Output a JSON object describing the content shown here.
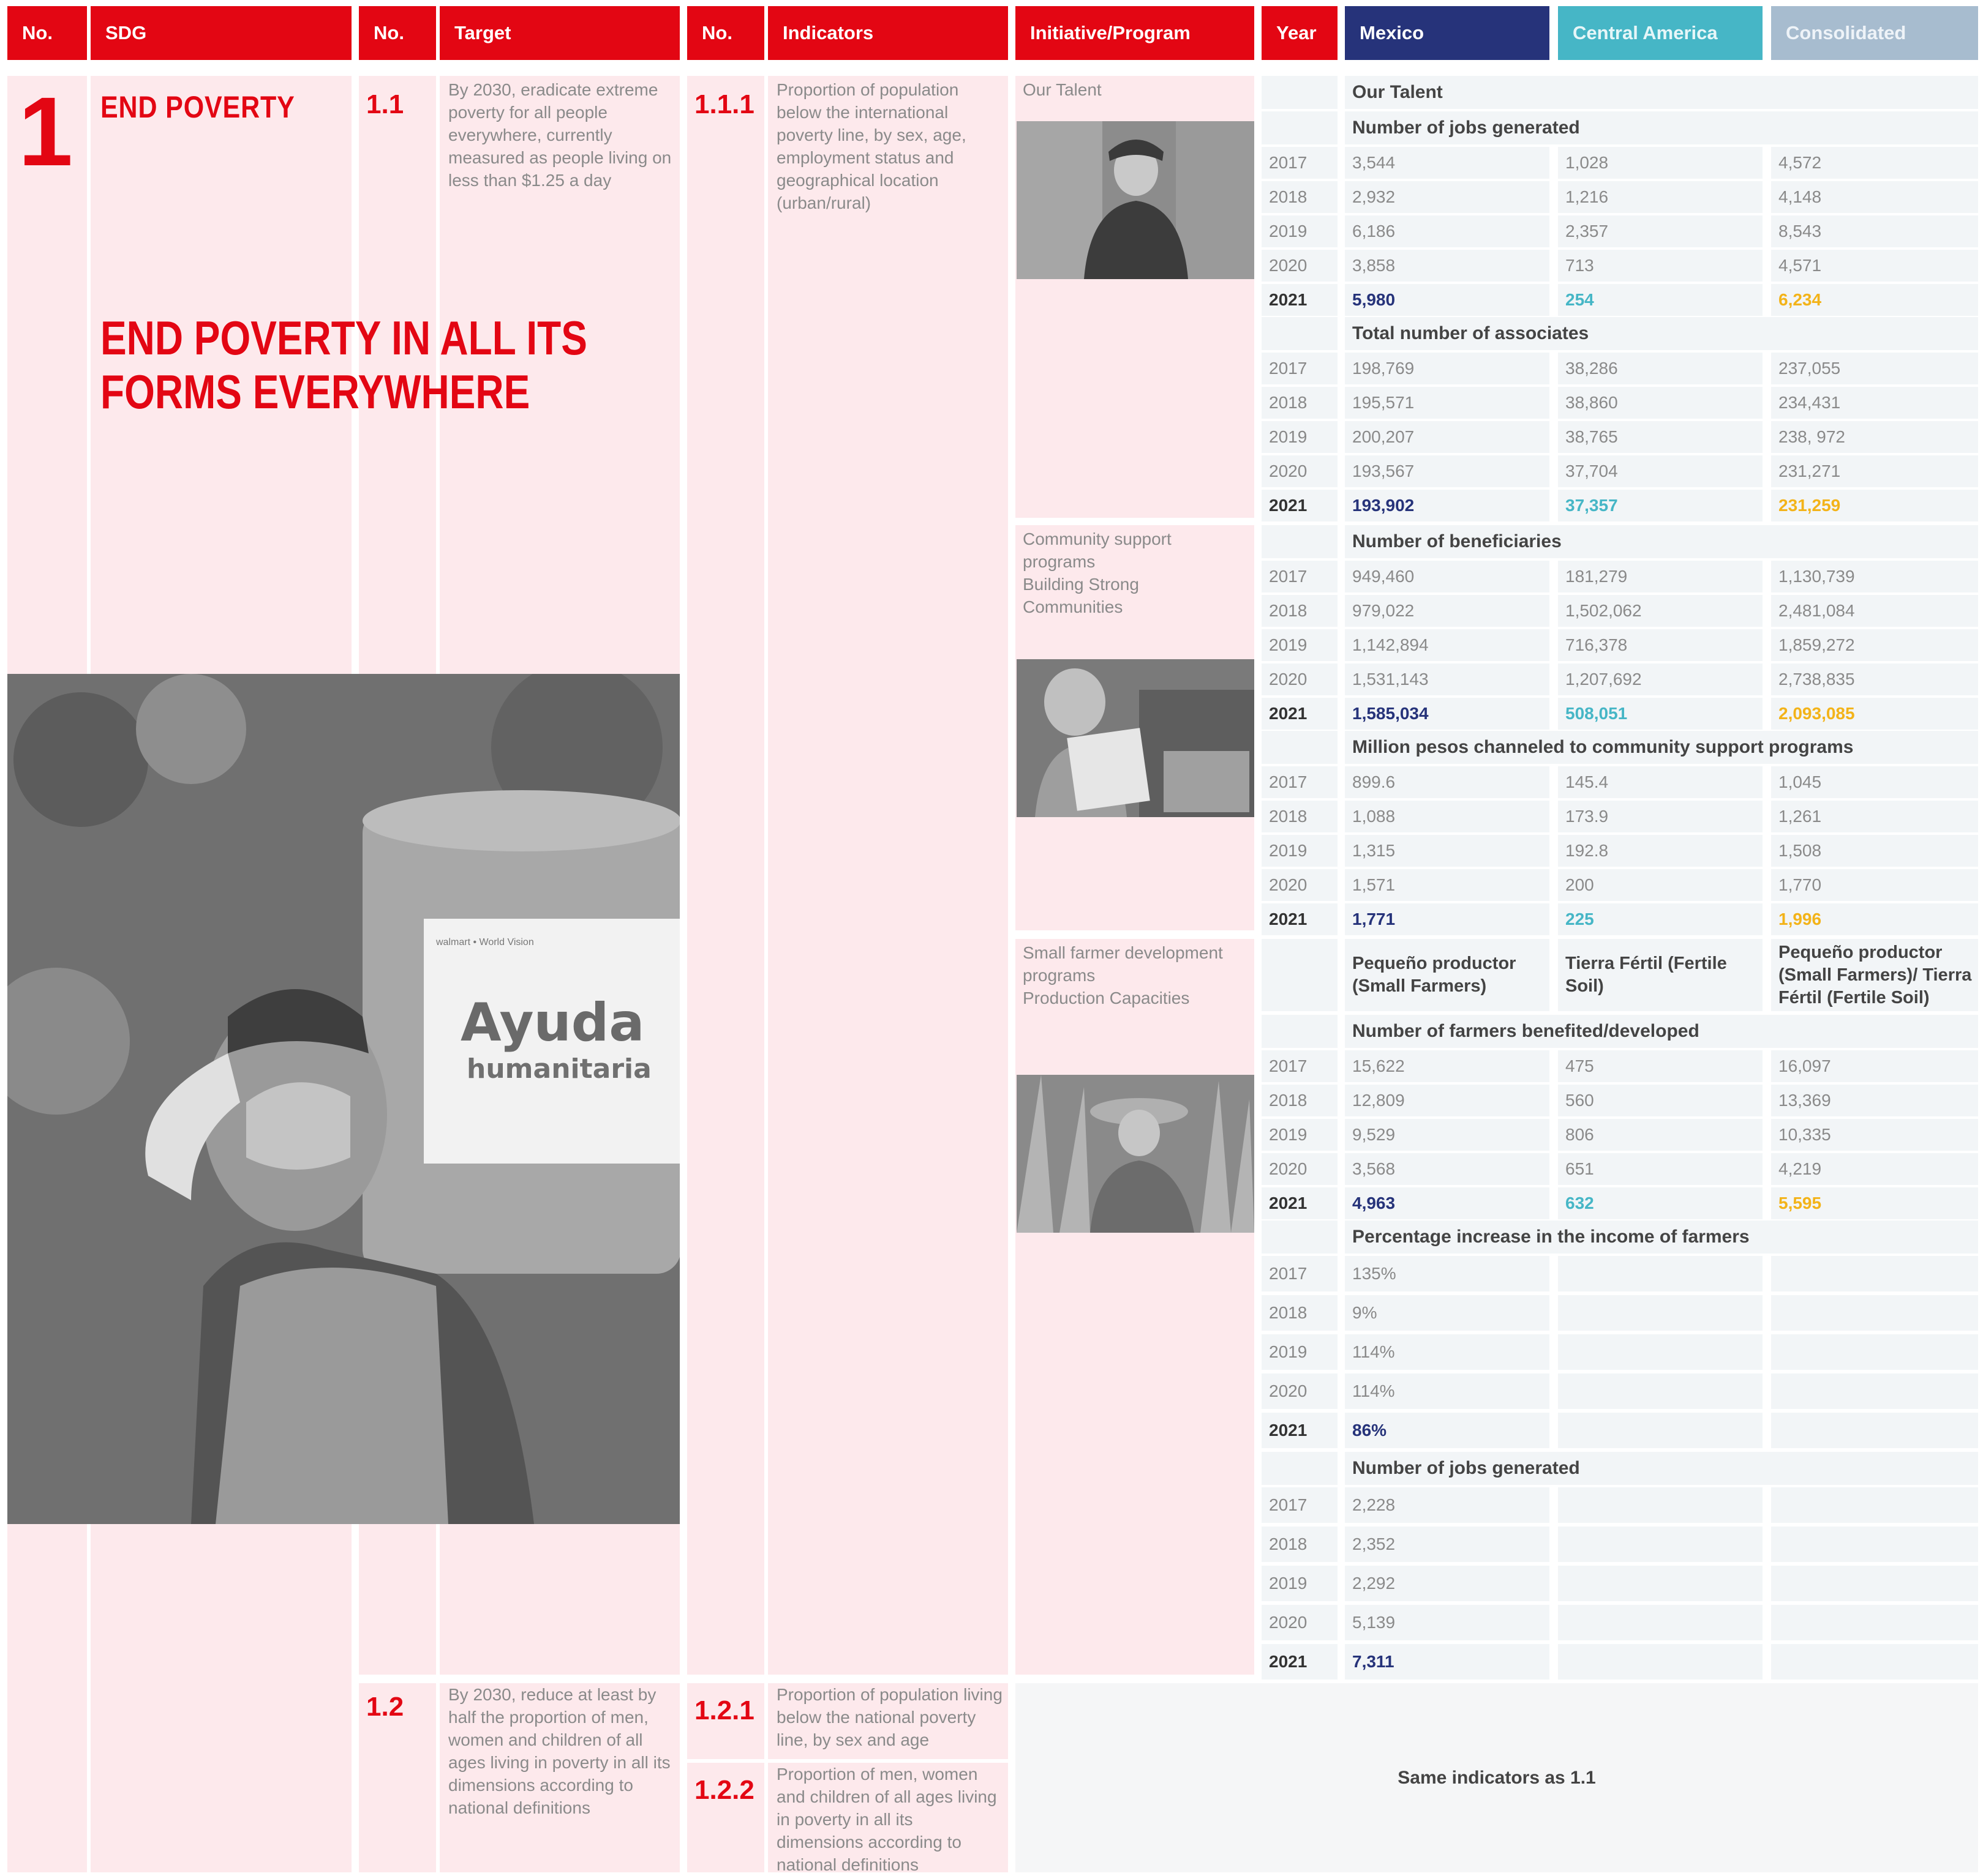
{
  "header": {
    "no1": "No.",
    "sdg": "SDG",
    "no2": "No.",
    "target": "Target",
    "no3": "No.",
    "indicators": "Indicators",
    "initiative": "Initiative/Program",
    "year": "Year",
    "mexico": "Mexico",
    "central_america": "Central America",
    "consolidated": "Consolidated",
    "colors": {
      "red": "#e30613",
      "mexico": "#26337a",
      "central_america": "#46b6c6",
      "consolidated": "#a7bccf"
    }
  },
  "sdg": {
    "number": "1",
    "title": "END POVERTY",
    "subtitle": "END POVERTY IN ALL ITS FORMS EVERYWHERE"
  },
  "targets": [
    {
      "no": "1.1",
      "text": "By 2030, eradicate extreme poverty for  all people everywhere, currently measured as people living on less than $1.25 a day"
    },
    {
      "no": "1.2",
      "text": "By 2030, reduce at least by half the proportion of men, women and children of all ages living in poverty in all its dimensions according to national definitions"
    }
  ],
  "indicators": [
    {
      "no": "1.1.1",
      "text": "Proportion of population below the international poverty line, by sex, age, employment status and geographical location (urban/rural)"
    },
    {
      "no": "1.2.1",
      "text": "Proportion of population living below the national poverty line, by sex and age"
    },
    {
      "no": "1.2.2",
      "text": "Proportion of men, women and children of all ages living in poverty in all its dimensions according to national definitions"
    }
  ],
  "initiatives": {
    "talent": "Our Talent",
    "community": [
      "Community support",
      "programs",
      "Building Strong",
      "Communities"
    ],
    "farmer": [
      "Small farmer development",
      "programs",
      "Production Capacities"
    ]
  },
  "photos": {
    "main_label_1": "Ayuda",
    "main_label_2": "humanitaria",
    "main_logos": "walmart • World Vision"
  },
  "tables": {
    "talent_title": "Our Talent",
    "jobs": {
      "title": "Number of jobs generated",
      "rows": [
        [
          "2017",
          "3,544",
          "1,028",
          "4,572"
        ],
        [
          "2018",
          "2,932",
          "1,216",
          "4,148"
        ],
        [
          "2019",
          "6,186",
          "2,357",
          "8,543"
        ],
        [
          "2020",
          "3,858",
          "713",
          "4,571"
        ],
        [
          "2021",
          "5,980",
          "254",
          "6,234"
        ]
      ]
    },
    "associates": {
      "title": "Total number of associates",
      "rows": [
        [
          "2017",
          "198,769",
          "38,286",
          "237,055"
        ],
        [
          "2018",
          "195,571",
          "38,860",
          "234,431"
        ],
        [
          "2019",
          "200,207",
          "38,765",
          "238, 972"
        ],
        [
          "2020",
          "193,567",
          "37,704",
          "231,271"
        ],
        [
          "2021",
          "193,902",
          "37,357",
          "231,259"
        ]
      ]
    },
    "beneficiaries": {
      "title": "Number of beneficiaries",
      "rows": [
        [
          "2017",
          "949,460",
          "181,279",
          "1,130,739"
        ],
        [
          "2018",
          "979,022",
          "1,502,062",
          "2,481,084"
        ],
        [
          "2019",
          "1,142,894",
          "716,378",
          "1,859,272"
        ],
        [
          "2020",
          "1,531,143",
          "1,207,692",
          "2,738,835"
        ],
        [
          "2021",
          "1,585,034",
          "508,051",
          "2,093,085"
        ]
      ]
    },
    "pesos": {
      "title": "Million pesos channeled to community support programs",
      "rows": [
        [
          "2017",
          "899.6",
          "145.4",
          "1,045"
        ],
        [
          "2018",
          "1,088",
          "173.9",
          "1,261"
        ],
        [
          "2019",
          "1,315",
          "192.8",
          "1,508"
        ],
        [
          "2020",
          "1,571",
          "200",
          "1,770"
        ],
        [
          "2021",
          "1,771",
          "225",
          "1,996"
        ]
      ]
    },
    "farmer_headers": [
      "Pequeño productor (Small Farmers)",
      "Tierra Fértil (Fertile Soil)",
      "Pequeño productor (Small Farmers)/ Tierra Fértil (Fertile Soil)"
    ],
    "farmers": {
      "title": "Number of farmers benefited/developed",
      "rows": [
        [
          "2017",
          "15,622",
          "475",
          "16,097"
        ],
        [
          "2018",
          "12,809",
          "560",
          "13,369"
        ],
        [
          "2019",
          "9,529",
          "806",
          "10,335"
        ],
        [
          "2020",
          "3,568",
          "651",
          "4,219"
        ],
        [
          "2021",
          "4,963",
          "632",
          "5,595"
        ]
      ]
    },
    "income": {
      "title": "Percentage increase in the income of farmers",
      "rows": [
        [
          "2017",
          "135%"
        ],
        [
          "2018",
          "9%"
        ],
        [
          "2019",
          "114%"
        ],
        [
          "2020",
          "114%"
        ],
        [
          "2021",
          "86%"
        ]
      ]
    },
    "farmer_jobs": {
      "title": "Number of jobs generated",
      "rows": [
        [
          "2017",
          "2,228"
        ],
        [
          "2018",
          "2,352"
        ],
        [
          "2019",
          "2,292"
        ],
        [
          "2020",
          "5,139"
        ],
        [
          "2021",
          "7,311"
        ]
      ]
    },
    "same_as": "Same indicators as 1.1"
  }
}
